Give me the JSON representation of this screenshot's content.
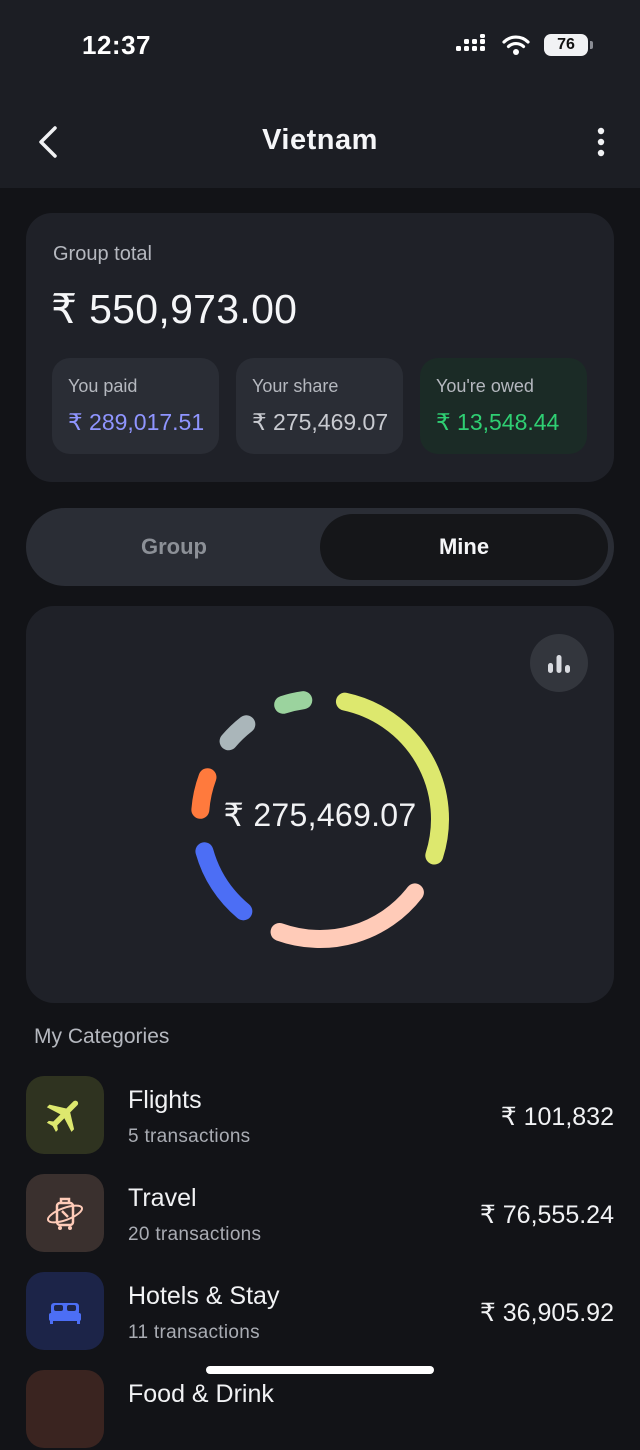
{
  "status_bar": {
    "time": "12:37",
    "battery": "76"
  },
  "header": {
    "title": "Vietnam"
  },
  "summary": {
    "label": "Group total",
    "total": "₹ 550,973.00",
    "paid_label": "You paid",
    "paid_value": "₹ 289,017.51",
    "share_label": "Your share",
    "share_value": "₹ 275,469.07",
    "owed_label": "You're owed",
    "owed_value": "₹ 13,548.44",
    "paid_color": "#8f95ff",
    "owed_color": "#2fcf73"
  },
  "toggle": {
    "group_label": "Group",
    "mine_label": "Mine",
    "selected": "Mine"
  },
  "chart": {
    "center_label": "₹ 275,469.07",
    "segments": [
      {
        "category": "Flights",
        "value": 101832,
        "color": "#dde86e"
      },
      {
        "category": "Travel",
        "value": 76555.24,
        "color": "#ffcbb8"
      },
      {
        "category": "Hotels & Stay",
        "value": 36905.92,
        "color": "#4c6ef5"
      },
      {
        "category": "orange-segment",
        "value": 17000,
        "color": "#ff7a3d"
      },
      {
        "category": "gray-segment",
        "value": 12500,
        "color": "#aab6ba"
      },
      {
        "category": "green-segment",
        "value": 10500,
        "color": "#9bd39e"
      }
    ]
  },
  "categories_section": {
    "title": "My Categories",
    "items": [
      {
        "name": "Flights",
        "count": "5 transactions",
        "amount": "₹ 101,832",
        "icon": "airplane-icon",
        "icon_bg": "#2f3320",
        "icon_color": "#dde86e"
      },
      {
        "name": "Travel",
        "count": "20 transactions",
        "amount": "₹ 76,555.24",
        "icon": "luggage-icon",
        "icon_bg": "#3a302e",
        "icon_color": "#ffcbb8"
      },
      {
        "name": "Hotels & Stay",
        "count": "11 transactions",
        "amount": "₹ 36,905.92",
        "icon": "bed-icon",
        "icon_bg": "#1c2448",
        "icon_color": "#4c6ef5"
      },
      {
        "name": "Food & Drink",
        "icon": "food-icon",
        "icon_bg": "#3a2420"
      }
    ]
  }
}
